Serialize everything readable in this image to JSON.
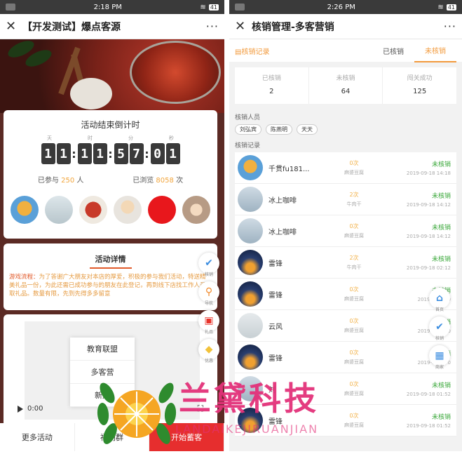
{
  "left": {
    "status_time": "2:18 PM",
    "battery": "41",
    "nav_title": "【开发测试】爆点客源",
    "more": "···",
    "countdown": {
      "title": "活动结束倒计时",
      "units": [
        "天",
        "时",
        "分",
        "秒"
      ],
      "days": [
        "1",
        "1"
      ],
      "hours": [
        "1",
        "1"
      ],
      "minutes": [
        "5",
        "7"
      ],
      "seconds": [
        "0",
        "1"
      ]
    },
    "stats": {
      "joined_prefix": "已参与",
      "joined_num": "250",
      "joined_suffix": "人",
      "views_prefix": "已浏览",
      "views_num": "8058",
      "views_suffix": "次"
    },
    "detail": {
      "title": "活动详情",
      "label": "游戏流程：",
      "text": "为了答谢广大朋友对本店的厚爱，积极的参与我们活动，特送精美礼品一份，为此还需已成功参与的朋友在此登记，再到线下店找工作人员领取礼品。数量有限，先到先得多多留意"
    },
    "menu_items": [
      "教育联盟",
      "多客营",
      "新建"
    ],
    "video_time": "0:00",
    "bottom": {
      "more": "更多活动",
      "welfare": "福利群",
      "start": "开始蓄客"
    },
    "float_labels": [
      "核销",
      "导航",
      "礼品",
      "优惠"
    ]
  },
  "right": {
    "status_time": "2:26 PM",
    "battery": "41",
    "nav_title": "核销管理-多客营销",
    "more": "···",
    "tabs": {
      "record": "核销记录",
      "done": "已核销",
      "pending": "未核销"
    },
    "summary": [
      {
        "label": "已核销",
        "value": "2"
      },
      {
        "label": "未核销",
        "value": "64"
      },
      {
        "label": "闯关成功",
        "value": "125"
      }
    ],
    "staff_label": "核销人员",
    "staff": [
      "刘弘宾",
      "陈燕明",
      "天天"
    ],
    "records_label": "核销记录",
    "records": [
      {
        "name": "千贯fu181...",
        "count": "0次",
        "product": "麻婆豆腐",
        "status": "未核销",
        "time": "2019-09-18 14:18"
      },
      {
        "name": "冰上咖啡",
        "count": "2次",
        "product": "牛肉干",
        "status": "未核销",
        "time": "2019-09-18 14:12"
      },
      {
        "name": "冰上咖啡",
        "count": "0次",
        "product": "麻婆豆腐",
        "status": "未核销",
        "time": "2019-09-18 14:12"
      },
      {
        "name": "雷锋",
        "count": "2次",
        "product": "牛肉干",
        "status": "未核销",
        "time": "2019-09-18 02:12"
      },
      {
        "name": "雷锋",
        "count": "0次",
        "product": "麻婆豆腐",
        "status": "未核销",
        "time": "2019-09-18 0"
      },
      {
        "name": "云风",
        "count": "0次",
        "product": "麻婆豆腐",
        "status": "未核销",
        "time": "2019-09-18 0"
      },
      {
        "name": "雷锋",
        "count": "0次",
        "product": "麻婆豆腐",
        "status": "未核销",
        "time": "2019-09-18 0"
      },
      {
        "name": "刘",
        "count": "0次",
        "product": "麻婆豆腐",
        "status": "未核销",
        "time": "2019-09-18 01:52"
      },
      {
        "name": "雷锋",
        "count": "0次",
        "product": "麻婆豆腐",
        "status": "未核销",
        "time": "2019-09-18 01:52"
      }
    ],
    "float_labels": [
      "首页",
      "核销",
      "商家"
    ]
  },
  "watermark": {
    "text": "兰黛科技",
    "sub": "LANDAIKEJIRUANJIAN"
  }
}
